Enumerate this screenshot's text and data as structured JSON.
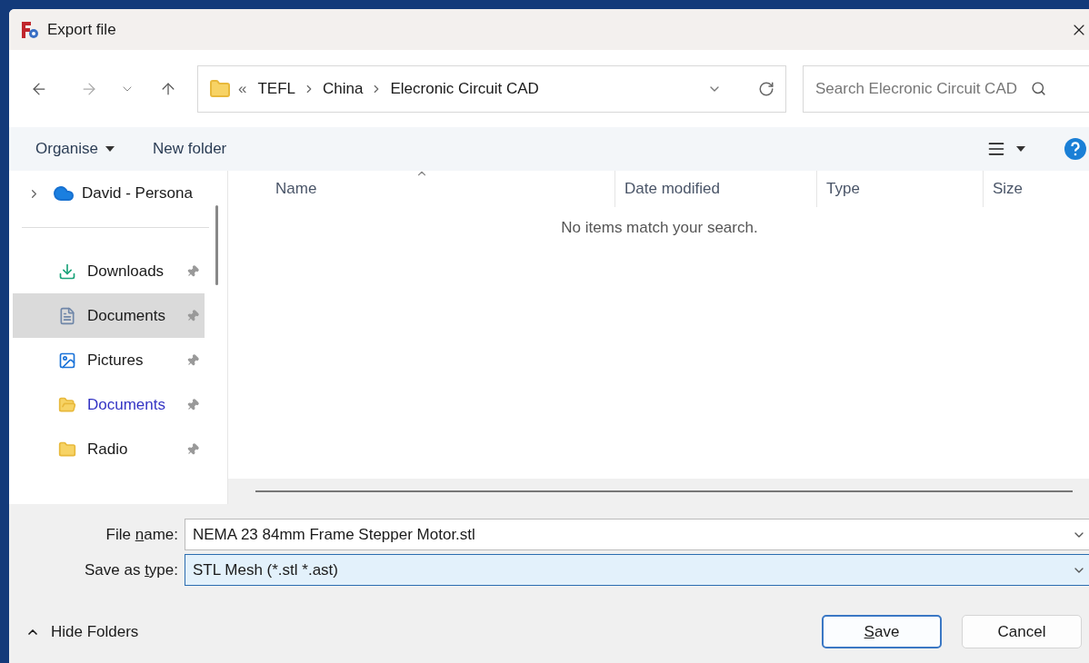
{
  "window": {
    "title": "Export file"
  },
  "address": {
    "overflow": "«",
    "crumbs": [
      "TEFL",
      "China",
      "Elecronic Circuit CAD"
    ]
  },
  "search": {
    "placeholder": "Search Elecronic Circuit CAD"
  },
  "toolbar": {
    "organise": "Organise",
    "new_folder": "New folder"
  },
  "sidebar": {
    "cloud": {
      "label": "David - Persona",
      "expanded": false
    },
    "items": [
      {
        "label": "Downloads",
        "kind": "download",
        "selected": false,
        "pinned": true,
        "color": "#1a1a1a"
      },
      {
        "label": "Documents",
        "kind": "document",
        "selected": true,
        "pinned": true,
        "color": "#1a1a1a"
      },
      {
        "label": "Pictures",
        "kind": "picture",
        "selected": false,
        "pinned": true,
        "color": "#1a1a1a"
      },
      {
        "label": "Documents",
        "kind": "library",
        "selected": false,
        "pinned": true,
        "color": "#3434c4"
      },
      {
        "label": "Radio",
        "kind": "folder",
        "selected": false,
        "pinned": true,
        "color": "#1a1a1a"
      }
    ]
  },
  "columns": [
    {
      "label": "Name",
      "sorted": true
    },
    {
      "label": "Date modified",
      "sorted": false
    },
    {
      "label": "Type",
      "sorted": false
    },
    {
      "label": "Size",
      "sorted": false
    }
  ],
  "empty_message": "No items match your search.",
  "fields": [
    {
      "label": {
        "before": "File ",
        "key": "n",
        "after": "ame:"
      },
      "value": "NEMA 23 84mm Frame Stepper Motor.stl",
      "focused": false
    },
    {
      "label": {
        "before": "Save as ",
        "key": "t",
        "after": "ype:"
      },
      "value": "STL Mesh (*.stl *.ast)",
      "focused": true
    }
  ],
  "hide_folders": "Hide Folders",
  "buttons": [
    {
      "label": {
        "key": "S",
        "after": "ave"
      },
      "default": true
    },
    {
      "label": {
        "before": "Cancel"
      },
      "default": false
    }
  ]
}
